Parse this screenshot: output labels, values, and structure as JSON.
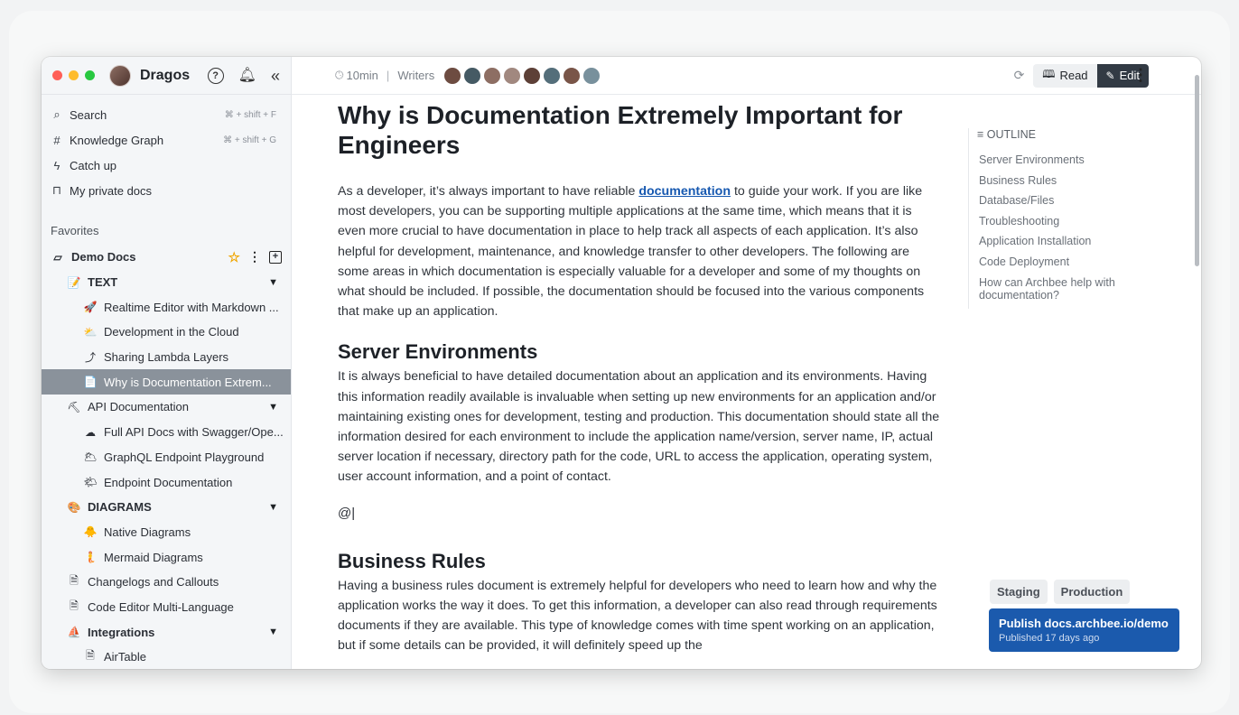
{
  "user": {
    "name": "Dragos"
  },
  "quick_actions": [
    {
      "icon": "search-icon",
      "label": "Search",
      "shortcut": "⌘ + shift + F"
    },
    {
      "icon": "knowledge-graph-icon",
      "label": "Knowledge Graph",
      "shortcut": "⌘ + shift + G"
    },
    {
      "icon": "lightning-icon",
      "label": "Catch up",
      "shortcut": ""
    },
    {
      "icon": "lock-icon",
      "label": "My private docs",
      "shortcut": ""
    }
  ],
  "favorites_title": "Favorites",
  "tree": [
    {
      "level": 0,
      "icon": "▱",
      "label": "Demo Docs",
      "bold": true
    },
    {
      "level": 1,
      "icon": "📝",
      "label": "TEXT",
      "bold": true,
      "toggle": "▼"
    },
    {
      "level": 2,
      "icon": "🚀",
      "label": "Realtime Editor with Markdown ..."
    },
    {
      "level": 2,
      "icon": "⛅",
      "label": "Development in the Cloud"
    },
    {
      "level": 2,
      "icon": "⤴",
      "label": "Sharing Lambda Layers"
    },
    {
      "level": 2,
      "icon": "📄",
      "label": "Why is Documentation Extrem...",
      "active": true
    },
    {
      "level": 1,
      "icon": "⛏",
      "label": "API Documentation",
      "toggle": "▼"
    },
    {
      "level": 2,
      "icon": "☁",
      "label": "Full API Docs with Swagger/Ope..."
    },
    {
      "level": 2,
      "icon": "🌥",
      "label": "GraphQL Endpoint Playground"
    },
    {
      "level": 2,
      "icon": "🌤",
      "label": "Endpoint Documentation"
    },
    {
      "level": 1,
      "icon": "🎨",
      "label": "DIAGRAMS",
      "bold": true,
      "toggle": "▼"
    },
    {
      "level": 2,
      "icon": "🐥",
      "label": "Native Diagrams"
    },
    {
      "level": 2,
      "icon": "🧜",
      "label": "Mermaid Diagrams"
    },
    {
      "level": 1,
      "icon": "🗎",
      "label": "Changelogs and Callouts"
    },
    {
      "level": 1,
      "icon": "🗎",
      "label": "Code Editor Multi-Language"
    },
    {
      "level": 1,
      "icon": "⛵",
      "label": "Integrations",
      "bold": true,
      "toggle": "▼"
    },
    {
      "level": 2,
      "icon": "🗎",
      "label": "AirTable"
    }
  ],
  "topbar": {
    "read_time": "10min",
    "writers_label": "Writers",
    "read_label": "Read",
    "edit_label": "Edit"
  },
  "writer_colors": [
    "#6d4c41",
    "#455a64",
    "#8d6e63",
    "#a1887f",
    "#5d4037",
    "#546e7a",
    "#795548",
    "#78909c"
  ],
  "doc": {
    "title": "Why is Documentation Extremely Important for Engineers",
    "intro_before_link": "As a developer, it’s always important to have reliable ",
    "intro_link": "documentation",
    "intro_after_link": " to guide your work. If you are like most developers, you can be supporting multiple applications at the same time, which means that it is even more crucial to have documentation in place to help track all aspects of each application. It’s also helpful for development, maintenance, and knowledge transfer to other developers. The following are some areas in which documentation is especially valuable for a developer and some of my thoughts on what should be included. If possible, the documentation should be focused into the various components that make up an application.",
    "h_server": "Server Environments",
    "p_server": "It is always beneficial to have detailed documentation about an application and its environments. Having this information readily available is invaluable when setting up new environments for an application and/or maintaining existing ones for development, testing and production. This documentation should state all the information desired for each environment to include the application name/version, server name, IP, actual server location if necessary, directory path for the code, URL to access the application, operating system, user account information, and a point of contact.",
    "mention": "@|",
    "h_business": "Business Rules",
    "p_business": "Having a business rules document is extremely helpful for developers who need to learn how and why the application works the way it does. To get this information, a developer can also read through requirements documents if they are available. This type of knowledge comes with time spent working on an application, but if some details can be provided, it will definitely speed up the"
  },
  "outline": {
    "title": "OUTLINE",
    "items": [
      "Server Environments",
      "Business Rules",
      "Database/Files",
      "Troubleshooting",
      "Application Installation",
      "Code Deployment",
      "How can Archbee help with documentation?"
    ]
  },
  "environments": [
    "Staging",
    "Production"
  ],
  "publish": {
    "title": "Publish docs.archbee.io/demo",
    "subtitle": "Published 17 days ago"
  }
}
